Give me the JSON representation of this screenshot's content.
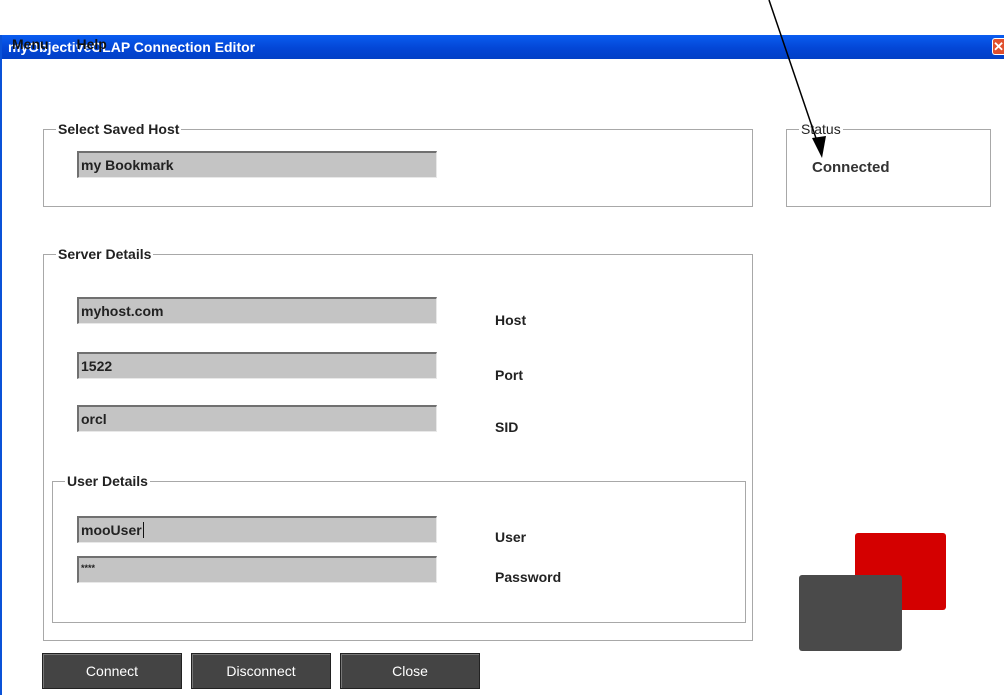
{
  "window": {
    "title": "myObjectiveOLAP Connection Editor",
    "close_glyph": "✕"
  },
  "menu": {
    "items": [
      "Menu",
      "Help"
    ]
  },
  "saved_host": {
    "legend": "Select Saved Host",
    "value": "my Bookmark"
  },
  "status": {
    "legend": "Status",
    "value": "Connected"
  },
  "server": {
    "legend": "Server Details",
    "host": {
      "value": "myhost.com",
      "label": "Host"
    },
    "port": {
      "value": "1522",
      "label": "Port"
    },
    "sid": {
      "value": "orcl",
      "label": "SID"
    }
  },
  "user": {
    "legend": "User Details",
    "user": {
      "value": "mooUser",
      "label": "User"
    },
    "password": {
      "value": "****",
      "label": "Password"
    }
  },
  "buttons": {
    "connect": "Connect",
    "disconnect": "Disconnect",
    "close": "Close"
  },
  "colors": {
    "title_bar": "#0346d6",
    "logo_red": "#d40000",
    "logo_grey": "#4a4a4a",
    "field_bg": "#c4c4c4",
    "button_bg": "#444444"
  },
  "icons": {
    "close": "close-icon",
    "annotation": "annotation-arrow-icon"
  }
}
